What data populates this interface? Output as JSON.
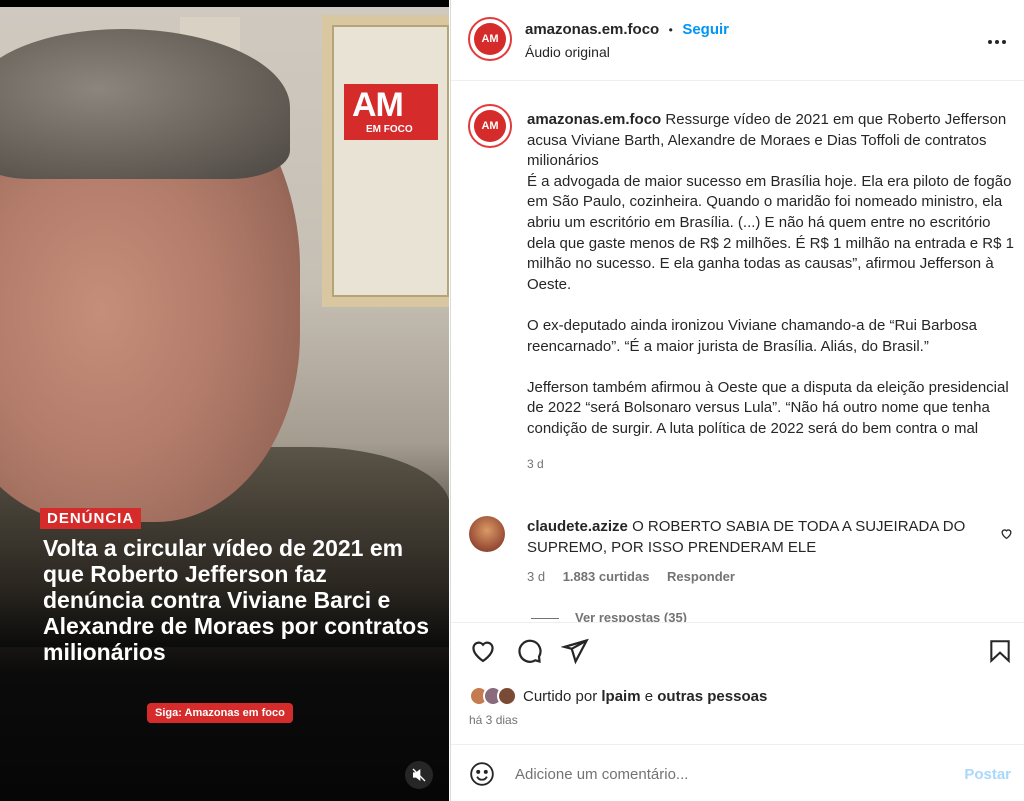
{
  "media": {
    "logo_big": "AM",
    "logo_small": "EM FOCO",
    "tag": "DENÚNCIA",
    "headline": "Volta a circular vídeo de 2021 em que Roberto Jefferson faz denúncia contra Viviane Barci e Alexandre de Moraes por contratos milionários",
    "siga": "Siga: Amazonas em foco",
    "mute_icon": "speaker-muted-icon"
  },
  "header": {
    "username": "amazonas.em.foco",
    "separator": "•",
    "follow_label": "Seguir",
    "audio": "Áudio original",
    "avatar_text": "AM",
    "more_icon": "more-horizontal-icon"
  },
  "caption": {
    "username": "amazonas.em.foco",
    "avatar_text": "AM",
    "lead": "Ressurge vídeo de 2021 em que Roberto Jefferson acusa Viviane Barth, Alexandre de Moraes e Dias Toffoli de contratos milionários",
    "para1": "É a advogada de maior sucesso em Brasília hoje. Ela era piloto de fogão em São Paulo, cozinheira. Quando o maridão foi nomeado ministro, ela abriu um escritório em Brasília. (...) E não há quem entre no escritório dela que gaste menos de R$ 2 milhões. É R$ 1 milhão na entrada e R$ 1 milhão no sucesso. E ela ganha todas as causas”, afirmou Jefferson à Oeste.",
    "para2": "O ex-deputado ainda ironizou Viviane chamando-a de “Rui Barbosa reencarnado”. “É a maior jurista de Brasília. Aliás, do Brasil.”",
    "para3": "Jefferson também afirmou à Oeste que a disputa da eleição presidencial de 2022 “será Bolsonaro versus Lula”. “Não há outro nome que tenha condição de surgir. A luta política de 2022 será do bem contra o mal",
    "age": "3 d"
  },
  "comment": {
    "username": "claudete.azize",
    "text": "O ROBERTO SABIA DE TODA A SUJEIRADA DO SUPREMO, POR ISSO PRENDERAM ELE",
    "age": "3 d",
    "likes": "1.883 curtidas",
    "reply": "Responder",
    "view_replies": "Ver respostas (35)"
  },
  "actions": {
    "like_icon": "heart-icon",
    "comment_icon": "comment-icon",
    "share_icon": "share-icon",
    "save_icon": "bookmark-icon",
    "liked_prefix": "Curtido por",
    "liked_user": "lpaim",
    "liked_and": "e",
    "liked_others": "outras pessoas",
    "when": "há 3 dias"
  },
  "add_comment": {
    "emoji_icon": "emoji-icon",
    "placeholder": "Adicione um comentário...",
    "post_label": "Postar"
  },
  "colors": {
    "brand_red": "#d52b2b",
    "link_blue": "#0095f6",
    "muted": "#737373"
  }
}
